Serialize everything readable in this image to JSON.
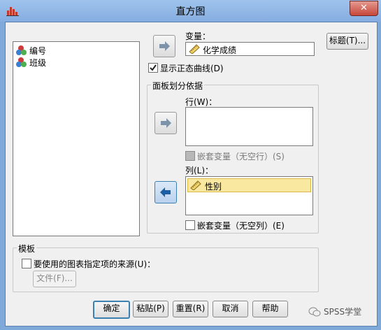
{
  "window": {
    "title": "直方图",
    "close": "✕"
  },
  "variables": [
    {
      "name": "编号"
    },
    {
      "name": "班级"
    }
  ],
  "variable_field": {
    "label": "变量：",
    "value": "化学成绩"
  },
  "options": {
    "normal_curve": {
      "label": "显示正态曲线(D)",
      "checked": true
    }
  },
  "panel": {
    "title": "面板划分依据",
    "rows": {
      "label": "行(W)：",
      "nest": {
        "label": "嵌套变量（无空行）(S)",
        "checked": false,
        "enabled": false
      }
    },
    "columns": {
      "label": "列(L)：",
      "items": [
        "性别"
      ],
      "nest": {
        "label": "嵌套变量（无空列）(E)",
        "checked": false
      }
    }
  },
  "template": {
    "title": "模板",
    "use_spec": {
      "label": "要使用的图表指定项的来源(U)：",
      "checked": false
    },
    "file_button": "文件(F)..."
  },
  "side_buttons": {
    "titles": "标题(T)..."
  },
  "buttons": {
    "ok": "确定",
    "paste": "粘贴(P)",
    "reset": "重置(R)",
    "cancel": "取消",
    "help": "帮助"
  },
  "watermark": "SPSS学堂",
  "colors": {
    "title_bar": "#85ade0",
    "accent": "#3c7fb1",
    "selection": "#f9e8a0"
  }
}
